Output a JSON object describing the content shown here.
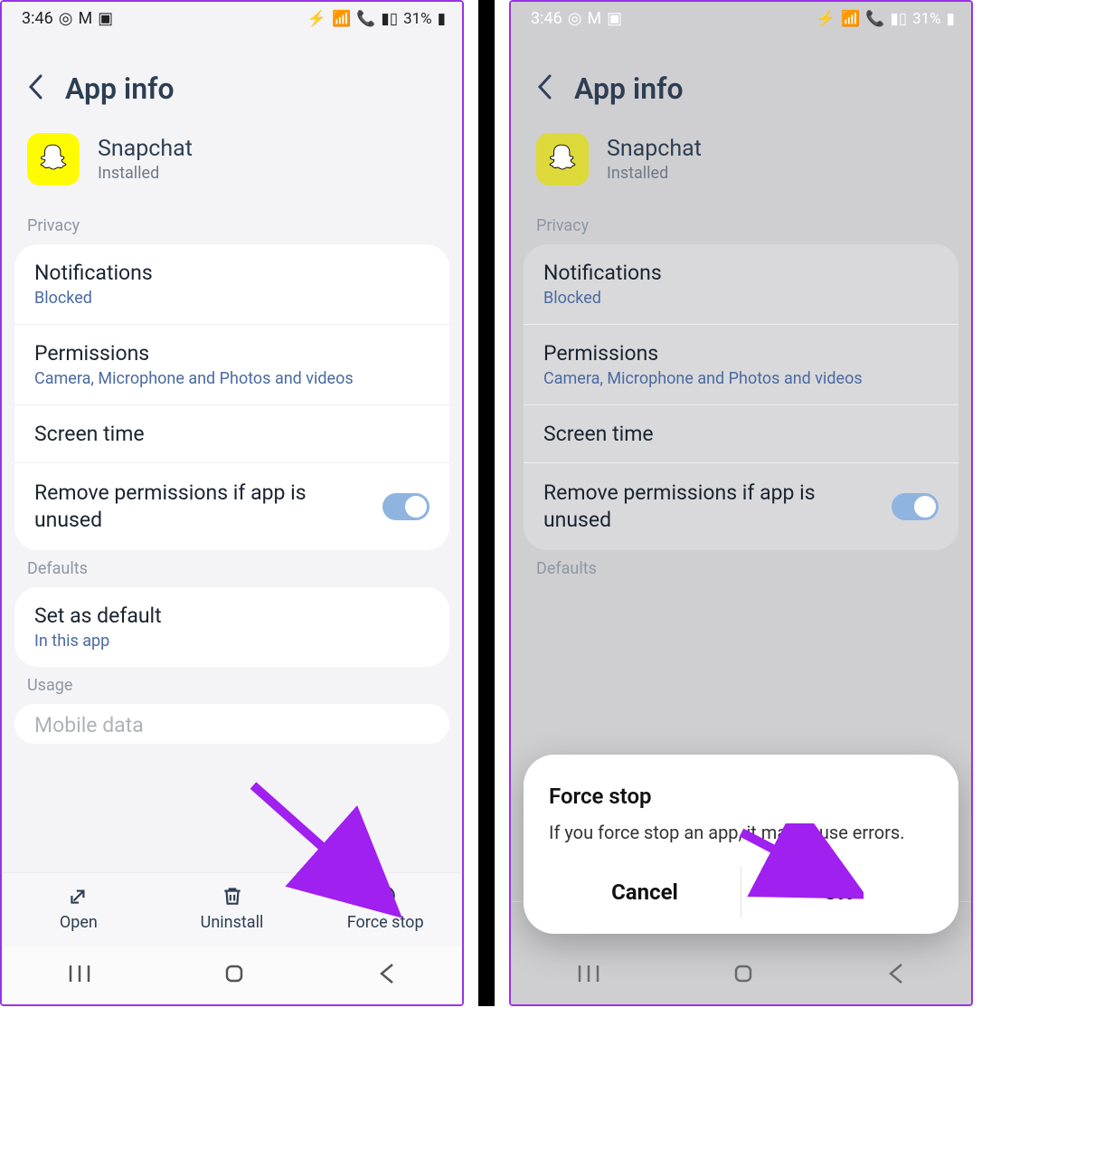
{
  "statusbar": {
    "time": "3:46",
    "battery_text": "31%"
  },
  "header": {
    "title": "App info"
  },
  "app": {
    "name": "Snapchat",
    "status": "Installed"
  },
  "sections": {
    "privacy_label": "Privacy",
    "defaults_label": "Defaults",
    "usage_label": "Usage"
  },
  "rows": {
    "notifications": {
      "title": "Notifications",
      "sub": "Blocked"
    },
    "permissions": {
      "title": "Permissions",
      "sub": "Camera, Microphone and Photos and videos"
    },
    "screen_time": {
      "title": "Screen time"
    },
    "remove_perm": {
      "title": "Remove permissions if app is unused",
      "value": true
    },
    "set_default": {
      "title": "Set as default",
      "sub": "In this app"
    },
    "mobile_data": {
      "title": "Mobile data"
    }
  },
  "actions": {
    "open": "Open",
    "uninstall": "Uninstall",
    "force_stop": "Force stop"
  },
  "dialog": {
    "title": "Force stop",
    "body": "If you force stop an app, it may cause errors.",
    "cancel": "Cancel",
    "ok": "OK"
  },
  "colors": {
    "accent_arrow": "#a020f0",
    "app_icon_bg": "#fffc00"
  }
}
